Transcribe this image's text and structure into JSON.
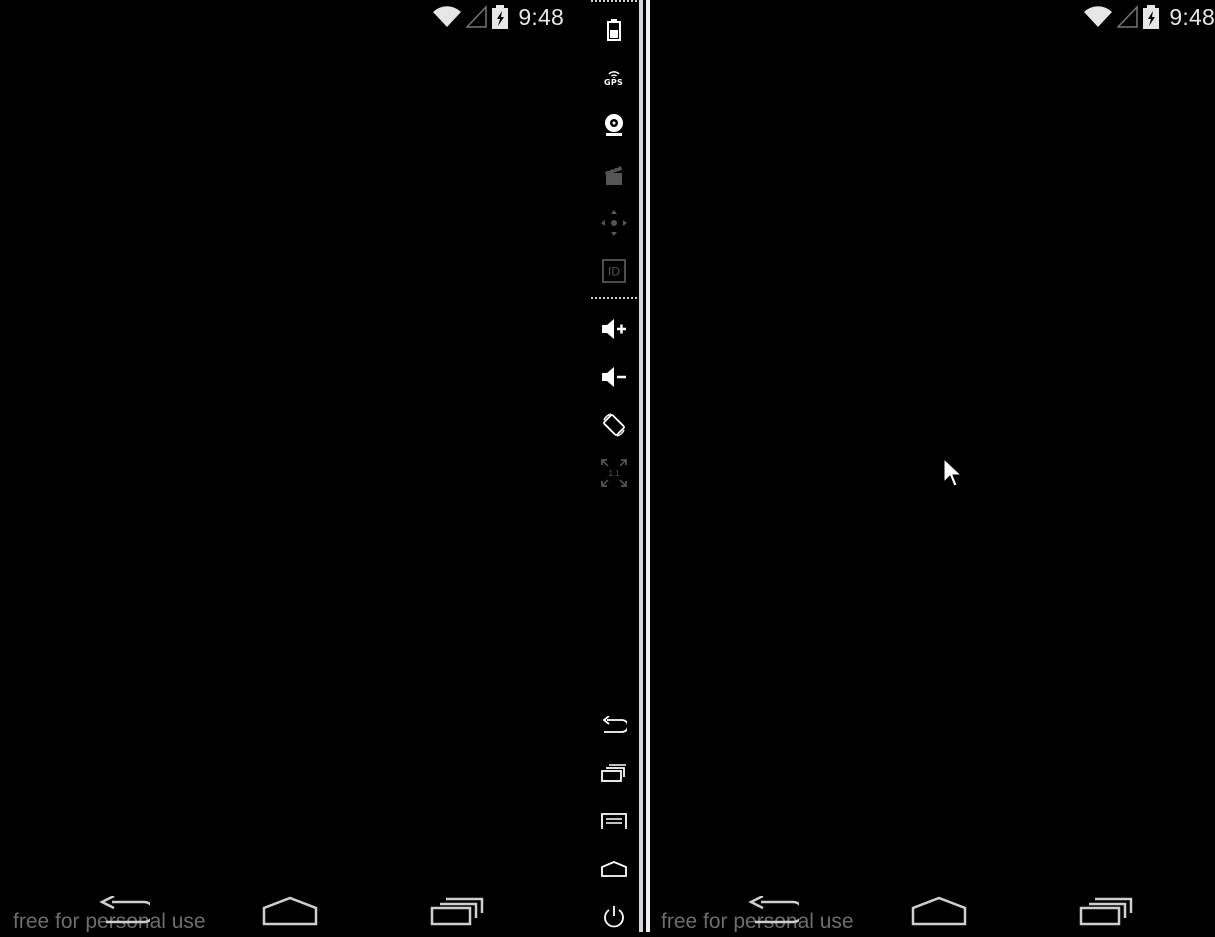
{
  "left_screen": {
    "status": {
      "time": "9:48"
    },
    "navbar": {
      "watermark": "free for personal use",
      "buttons": [
        "back",
        "home",
        "recent-apps"
      ]
    }
  },
  "right_screen": {
    "status": {
      "time": "9:48"
    },
    "navbar": {
      "watermark": "free for personal use",
      "buttons": [
        "back",
        "home",
        "recent-apps"
      ]
    }
  },
  "toolbar": {
    "top_icons": [
      "battery-icon",
      "gps-icon",
      "camera-icon",
      "video-clapper-icon",
      "dpad-icon",
      "id-icon"
    ],
    "gps_label": "GPS",
    "id_label": "ID",
    "zoom_label": "1:1",
    "controls": [
      "volume-up-icon",
      "volume-down-icon",
      "rotate-icon",
      "fullscreen-icon"
    ],
    "bottom_icons": [
      "back-icon",
      "recent-apps-icon",
      "menu-icon",
      "home-icon",
      "power-icon"
    ]
  },
  "colors": {
    "background": "#000000",
    "divider": "#d8d4de",
    "icon_active": "#ffffff",
    "icon_disabled": "#555555",
    "watermark": "#6d6d6d"
  }
}
